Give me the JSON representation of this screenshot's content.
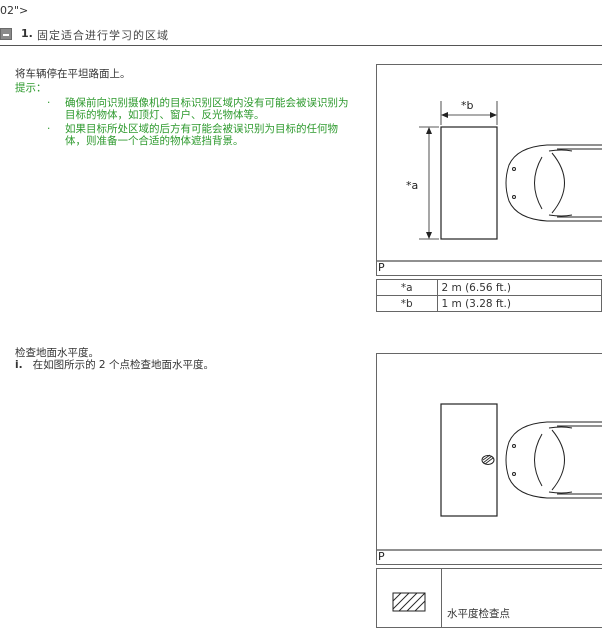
{
  "stray_text": "02\">",
  "section": {
    "number": "1.",
    "title": "固定适合进行学习的区域"
  },
  "step1": {
    "instruction": "将车辆停在平坦路面上。",
    "hint_label": "提示：",
    "hints": [
      {
        "bullet": "·",
        "line1": "确保前向识别摄像机的目标识别区域内没有可能会被误识别为",
        "line2": "目标的物体，如顶灯、窗户、反光物体等。"
      },
      {
        "bullet": "·",
        "line1": "如果目标所处区域的后方有可能会被误识别为目标的任何物",
        "line2": "体，则准备一个合适的物体遮挡背景。"
      }
    ],
    "figure": {
      "label_a": "*a",
      "label_b": "*b",
      "panel_label": "P"
    },
    "legend": [
      {
        "key": "*a",
        "value": "2 m (6.56 ft.)"
      },
      {
        "key": "*b",
        "value": "1 m (3.28 ft.)"
      }
    ]
  },
  "step2": {
    "instruction": "检查地面水平度。",
    "items": [
      {
        "label": "i.",
        "text": "在如图所示的 2 个点检查地面水平度。"
      }
    ],
    "figure": {
      "panel_label": "P"
    },
    "legend": {
      "text": "水平度检查点"
    }
  }
}
